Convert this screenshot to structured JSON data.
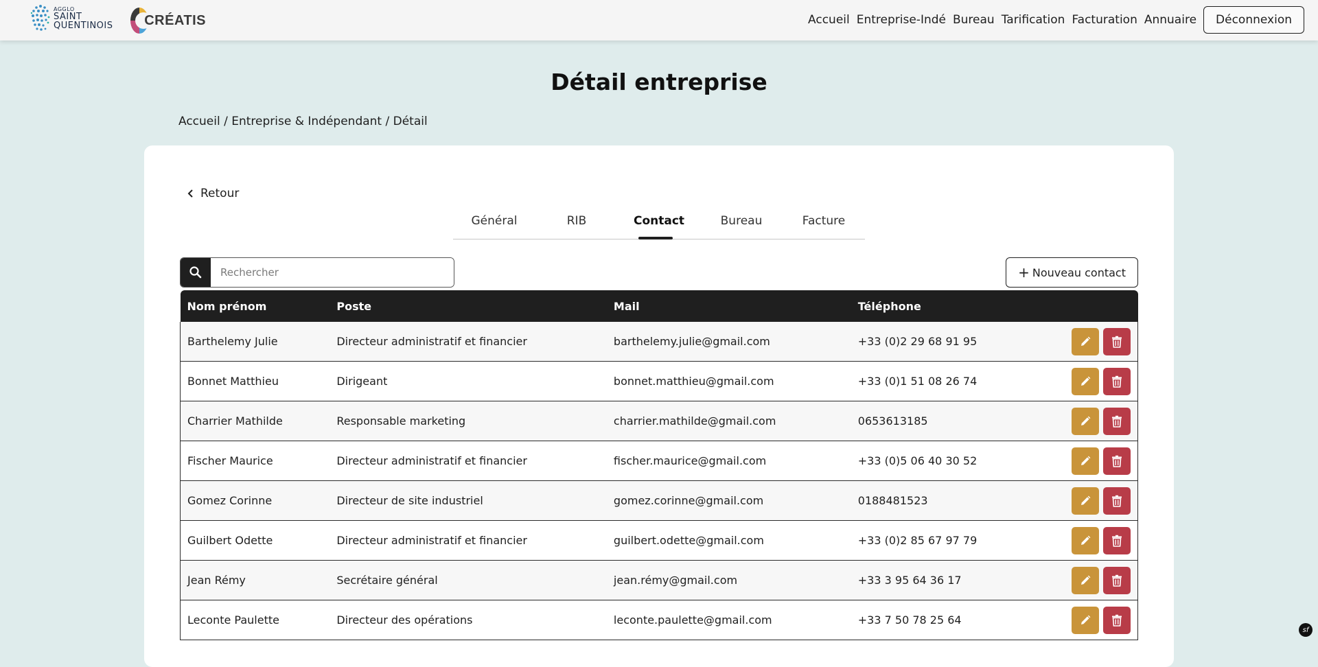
{
  "header": {
    "logo_agglo_small": "AGGLO",
    "logo_agglo_line1": "SAINT",
    "logo_agglo_line2": "QUENTINOIS",
    "logo_creatis": "CRÉATIS",
    "nav": [
      "Accueil",
      "Entreprise-Indé",
      "Bureau",
      "Tarification",
      "Facturation",
      "Annuaire"
    ],
    "logout_label": "Déconnexion"
  },
  "page": {
    "title": "Détail entreprise",
    "breadcrumb": "Accueil / Entreprise & Indépendant / Détail"
  },
  "card": {
    "back_label": "Retour",
    "tabs": [
      "Général",
      "RIB",
      "Contact",
      "Bureau",
      "Facture"
    ],
    "active_tab": "Contact",
    "search_placeholder": "Rechercher",
    "new_contact_label": "Nouveau contact"
  },
  "table": {
    "headers": [
      "Nom prénom",
      "Poste",
      "Mail",
      "Téléphone"
    ],
    "rows": [
      [
        "Barthelemy Julie",
        "Directeur administratif et financier",
        "barthelemy.julie@gmail.com",
        "+33 (0)2 29 68 91 95"
      ],
      [
        "Bonnet Matthieu",
        "Dirigeant",
        "bonnet.matthieu@gmail.com",
        "+33 (0)1 51 08 26 74"
      ],
      [
        "Charrier Mathilde",
        "Responsable marketing",
        "charrier.mathilde@gmail.com",
        "0653613185"
      ],
      [
        "Fischer Maurice",
        "Directeur administratif et financier",
        "fischer.maurice@gmail.com",
        "+33 (0)5 06 40 30 52"
      ],
      [
        "Gomez Corinne",
        "Directeur de site industriel",
        "gomez.corinne@gmail.com",
        "0188481523"
      ],
      [
        "Guilbert Odette",
        "Directeur administratif et financier",
        "guilbert.odette@gmail.com",
        "+33 (0)2 85 67 97 79"
      ],
      [
        "Jean Rémy",
        "Secrétaire général",
        "jean.rémy@gmail.com",
        "+33 3 95 64 36 17"
      ],
      [
        "Leconte Paulette",
        "Directeur des opérations",
        "leconte.paulette@gmail.com",
        "+33 7 50 78 25 64"
      ]
    ]
  },
  "colors": {
    "background": "#dfecec",
    "edit_button": "#c9943a",
    "delete_button": "#b83c48",
    "table_header": "#1f1f1f"
  },
  "icons": {
    "search": "search-icon",
    "edit": "pencil-icon",
    "delete": "trash-icon",
    "back": "chevron-left-icon",
    "add": "plus-icon"
  }
}
